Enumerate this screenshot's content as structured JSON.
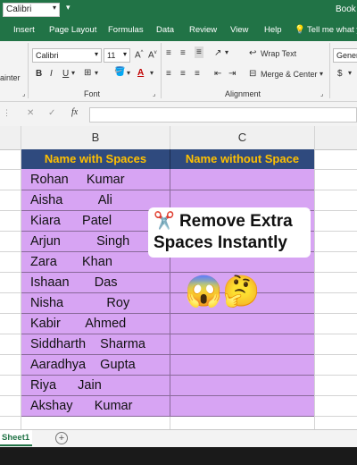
{
  "titlebar": {
    "font_value": "Calibri",
    "book_title": "Book"
  },
  "tabs": [
    "Insert",
    "Page Layout",
    "Formulas",
    "Data",
    "Review",
    "View",
    "Help",
    "Tell me what y"
  ],
  "ribbon": {
    "font_name": "Calibri",
    "font_size": "11",
    "bold": "B",
    "italic": "I",
    "underline": "U",
    "wrap_text": "Wrap Text",
    "merge_center": "Merge & Center",
    "number_format": "Genera",
    "currency": "$",
    "paste_partial": "ainter",
    "group_font": "Font",
    "group_alignment": "Alignment"
  },
  "formula_bar": {
    "fx": "fx",
    "cancel": "✕",
    "enter": "✓",
    "value": ""
  },
  "grid": {
    "col_b": "B",
    "col_c": "C",
    "header_b": "Name with Spaces",
    "header_c": "Name without Space",
    "names": [
      "Rohan     Kumar",
      "Aisha          Ali",
      "Kiara      Patel",
      "Arjun          Singh",
      "Zara       Khan",
      "Ishaan       Das",
      "Nisha            Roy",
      "Kabir       Ahmed",
      "Siddharth    Sharma",
      "Aaradhya    Gupta",
      "Riya      Jain",
      "Akshay      Kumar"
    ]
  },
  "overlay": {
    "line1": "Remove Extra",
    "line2": "Spaces Instantly",
    "scissors": "✂️",
    "emojis": "😱🤔"
  },
  "sheets": {
    "active": "Sheet1",
    "add": "+"
  }
}
